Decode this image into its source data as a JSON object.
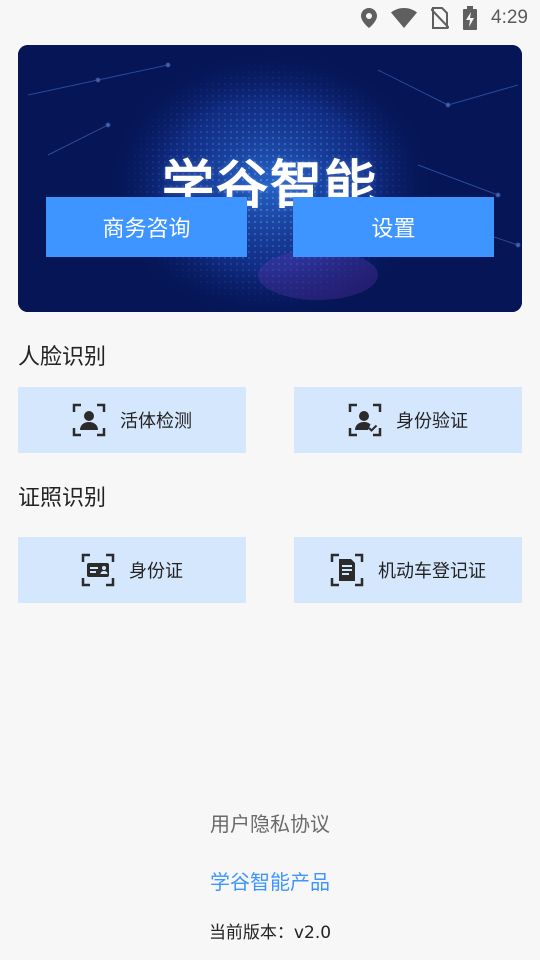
{
  "status_bar": {
    "time": "4:29",
    "icons": [
      "location-icon",
      "wifi-icon",
      "no-sim-icon",
      "battery-charging-icon"
    ]
  },
  "banner": {
    "title": "学谷智能",
    "consult_label": "商务咨询",
    "settings_label": "设置"
  },
  "face_section": {
    "title": "人脸识别",
    "items": [
      {
        "label": "活体检测",
        "icon": "face-scan-icon"
      },
      {
        "label": "身份验证",
        "icon": "face-verify-icon"
      }
    ]
  },
  "id_section": {
    "title": "证照识别",
    "items": [
      {
        "label": "身份证",
        "icon": "id-card-scan-icon"
      },
      {
        "label": "机动车登记证",
        "icon": "document-scan-icon"
      }
    ]
  },
  "footer": {
    "privacy": "用户隐私协议",
    "products": "学谷智能产品",
    "version": "当前版本：v2.0"
  },
  "colors": {
    "accent": "#3f95ff",
    "card_bg": "#d5e7fd",
    "banner_bg": "#051555",
    "page_bg": "#f7f7f7"
  }
}
